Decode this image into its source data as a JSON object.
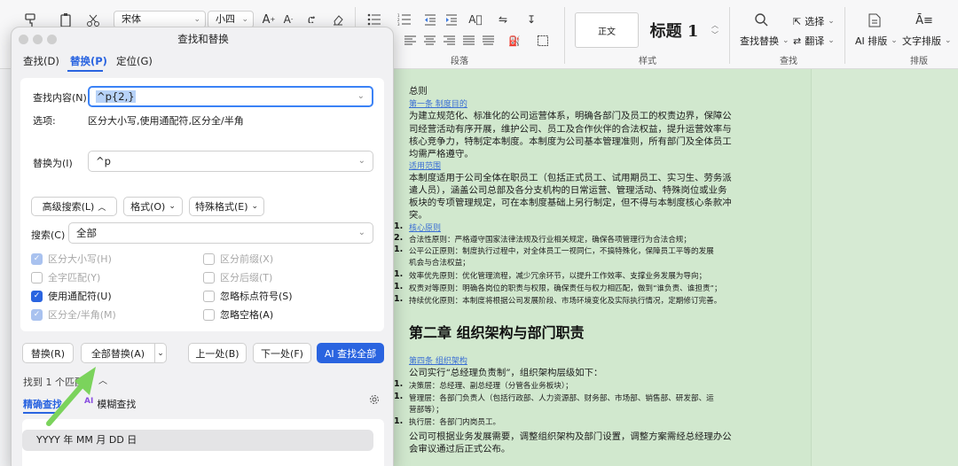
{
  "ribbon": {
    "font_name": "宋体",
    "font_size": "小四",
    "style_normal": "正文",
    "style_heading": "标题 1",
    "find_replace_label": "查找替换",
    "select_label": "选择",
    "translate_label": "翻译",
    "ai_layout_label": "AI 排版",
    "text_layout_label": "文字排版",
    "groups": {
      "paragraph": "段落",
      "styles": "样式",
      "find": "查找",
      "layout": "排版"
    }
  },
  "dialog": {
    "title": "查找和替换",
    "tabs": [
      "查找(D)",
      "替换(P)",
      "定位(G)"
    ],
    "find_label": "查找内容(N)",
    "find_value": "^p{2,}",
    "options_label": "选项:",
    "options_value": "区分大小写,使用通配符,区分全/半角",
    "replace_label": "替换为(I)",
    "replace_value": "^p",
    "advanced_search": "高级搜索(L)",
    "format": "格式(O)",
    "special": "特殊格式(E)",
    "search_label": "搜索(C)",
    "search_value": "全部",
    "checkboxes_left": [
      {
        "label": "区分大小写(H)",
        "checked": true,
        "disabled": true
      },
      {
        "label": "全字匹配(Y)",
        "checked": false,
        "disabled": true
      },
      {
        "label": "使用通配符(U)",
        "checked": true,
        "disabled": false
      },
      {
        "label": "区分全/半角(M)",
        "checked": true,
        "disabled": true
      }
    ],
    "checkboxes_right": [
      {
        "label": "区分前缀(X)",
        "checked": false,
        "disabled": true
      },
      {
        "label": "区分后缀(T)",
        "checked": false,
        "disabled": true
      },
      {
        "label": "忽略标点符号(S)",
        "checked": false,
        "disabled": false
      },
      {
        "label": "忽略空格(A)",
        "checked": false,
        "disabled": false
      }
    ],
    "replace_btn": "替换(R)",
    "replace_all_btn": "全部替换(A)",
    "prev_btn": "上一处(B)",
    "next_btn": "下一处(F)",
    "ai_find_all_btn": "AI 查找全部",
    "found_text": "找到 1 个匹配",
    "precise_tab": "精确查找",
    "fuzzy_tab": "模糊查找",
    "fuzzy_badge": "AI",
    "result_item": "YYYY 年 MM 月 DD 日"
  },
  "document": {
    "lines": [
      "总则",
      "第一条 制度目的",
      "为建立规范化、标准化的公司运营体系，明确各部门及员工的权责边界，保障公",
      "司经营活动有序开展，维护公司、员工及合作伙伴的合法权益，提升运营效率与",
      "核心竞争力，特制定本制度。本制度为公司基本管理准则，所有部门及全体员工",
      "均需严格遵守。",
      "适用范围",
      "本制度适用于公司全体在职员工（包括正式员工、试用期员工、实习生、劳务派",
      "遣人员），涵盖公司总部及各分支机构的日常运营、管理活动、特殊岗位或业务",
      "板块的专项管理规定，可在本制度基础上另行制定，但不得与本制度核心条款冲",
      "突。"
    ],
    "list_items": [
      {
        "n": "1.",
        "text": "核心原则"
      },
      {
        "n": "2.",
        "text": "合法性原则：严格遵守国家法律法规及行业相关规定，确保各项管理行为合法合规；"
      },
      {
        "n": "1.",
        "text": "公平公正原则：制度执行过程中，对全体员工一视同仁，不搞特殊化，保障员工平等的发展"
      },
      {
        "n": "",
        "text": "机会与合法权益；"
      },
      {
        "n": "1.",
        "text": "效率优先原则：优化管理流程，减少冗余环节，以提升工作效率、支撑业务发展为导向；"
      },
      {
        "n": "1.",
        "text": "权责对等原则：明确各岗位的职责与权限，确保责任与权力相匹配，做到“谁负责、谁担责”；"
      },
      {
        "n": "1.",
        "text": "持续优化原则：本制度将根据公司发展阶段、市场环境变化及实际执行情况，定期修订完善。"
      }
    ],
    "chapter_title": "第二章 组织架构与部门职责",
    "section4": "第四条 组织架构",
    "body2": [
      "公司实行“总经理负责制”，组织架构层级如下：",
      "决策层：总经理、副总经理（分管各业务板块）；",
      "管理层：各部门负责人（包括行政部、人力资源部、财务部、市场部、销售部、研发部、运",
      "营部等）；",
      "执行层：各部门内岗员工。",
      "公司可根据业务发展需要，调整组织架构及部门设置，调整方案需经总经理办公",
      "会审议通过后正式公布。"
    ]
  },
  "colors": {
    "accent": "#2a64e0",
    "doc_bg": "#d1e8ce",
    "annotation_arrow": "#7bd35c"
  }
}
